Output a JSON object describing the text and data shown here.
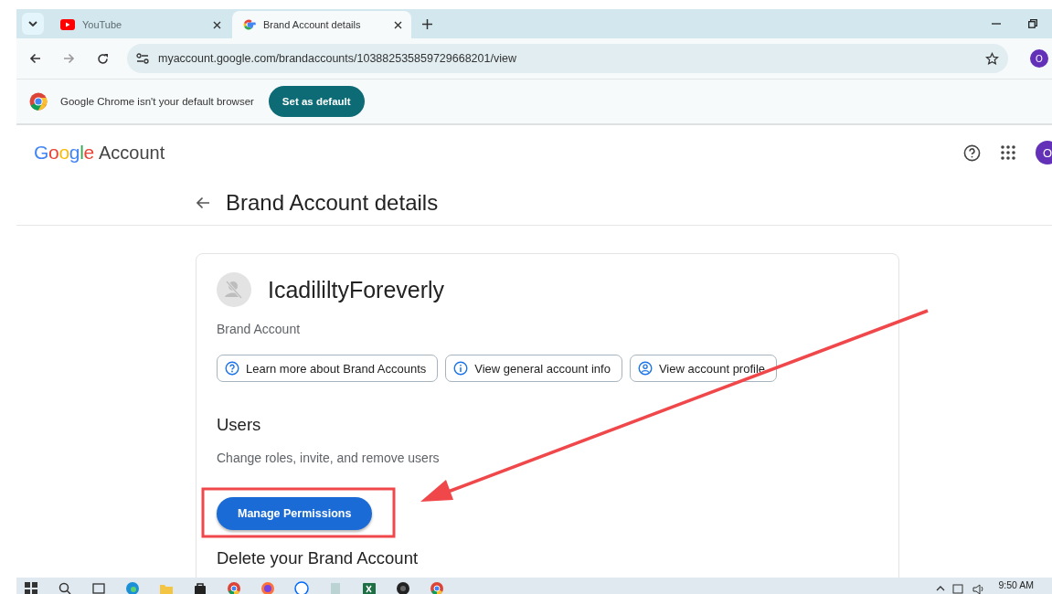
{
  "browser": {
    "tabs": [
      {
        "title": "YouTube",
        "kind": "youtube",
        "selected": false
      },
      {
        "title": "Brand Account details",
        "kind": "google",
        "selected": true
      }
    ],
    "address": "myaccount.google.com/brandaccounts/103882535859729668201/view",
    "profile_initial": "O",
    "infobar": {
      "message": "Google Chrome isn't your default browser",
      "button": "Set as default"
    }
  },
  "header": {
    "logo": "Google",
    "product": "Account",
    "avatar_initial": "O"
  },
  "page": {
    "title": "Brand Account details",
    "account_name": "IcadililtyForeverly",
    "account_type": "Brand Account",
    "links": [
      {
        "label": "Learn more about Brand Accounts",
        "kind": "help"
      },
      {
        "label": "View general account info",
        "kind": "info"
      },
      {
        "label": "View account profile",
        "kind": "profile"
      }
    ],
    "sections": [
      {
        "heading": "Users",
        "description": "Change roles, invite, and remove users",
        "button": "Manage Permissions"
      },
      {
        "heading": "Delete your Brand Account"
      }
    ]
  },
  "taskbar": {
    "time": "9:50 AM"
  }
}
